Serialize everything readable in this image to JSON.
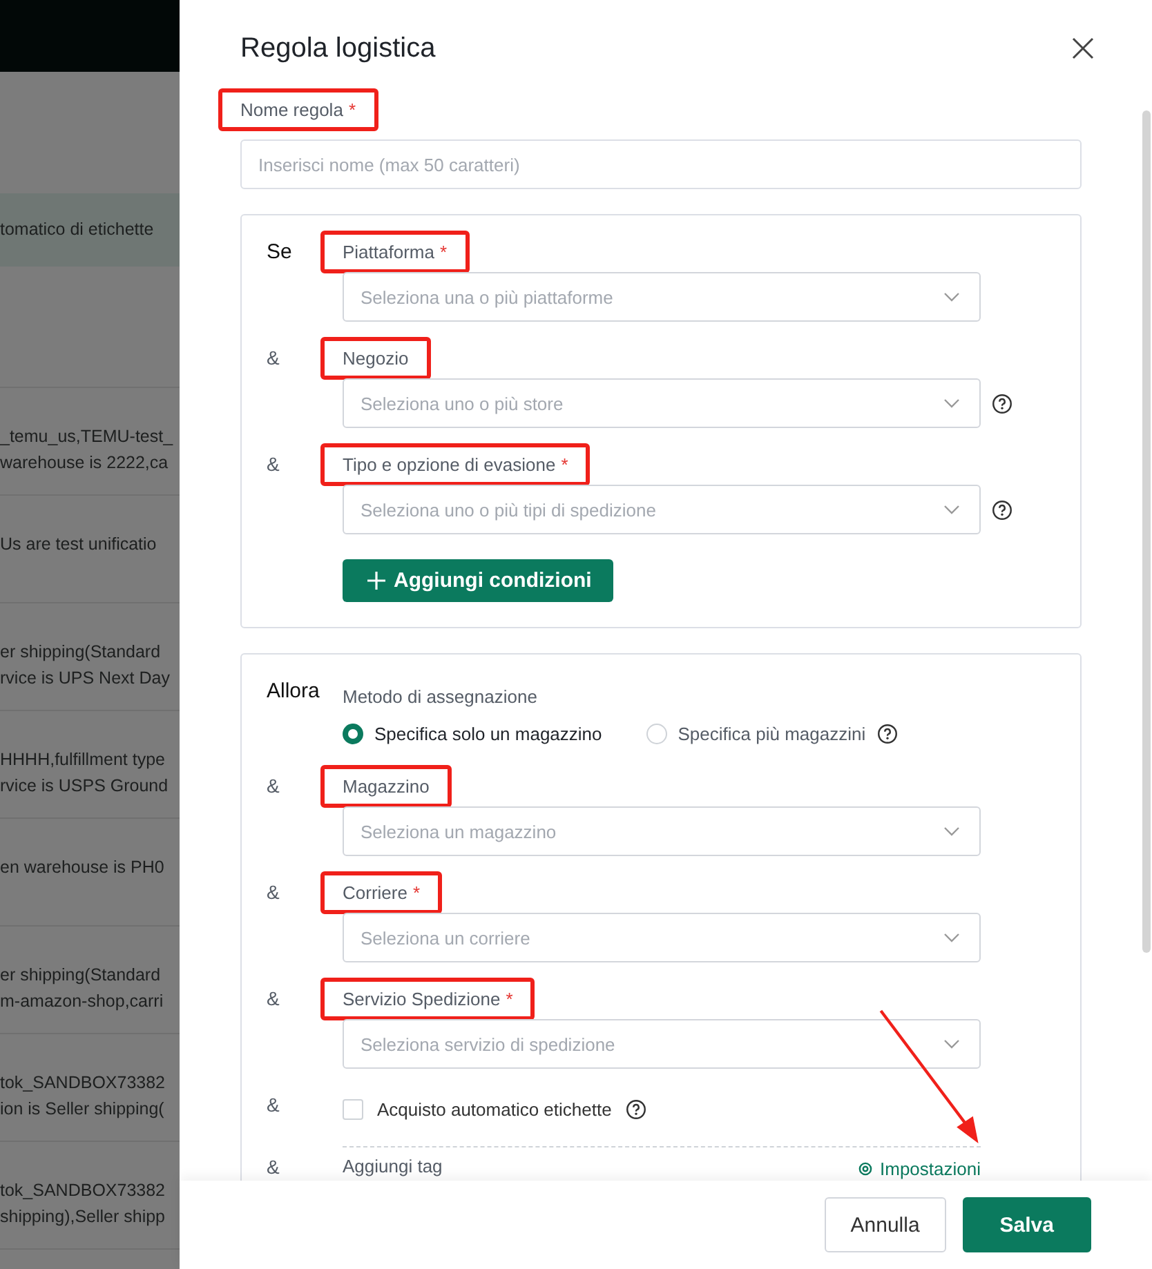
{
  "background": {
    "banner": "tomatico di etichette",
    "rows": [
      {
        "lines": [
          "_temu_us,TEMU-test_",
          "warehouse is 2222,ca"
        ]
      },
      {
        "lines": [
          "Us are test unificatio"
        ]
      },
      {
        "lines": [
          "er shipping(Standard",
          "rvice is UPS Next Day"
        ]
      },
      {
        "lines": [
          "HHHH,fulfillment type",
          "rvice is USPS Ground"
        ]
      },
      {
        "lines": [
          "en warehouse is PH0"
        ]
      },
      {
        "lines": [
          "er shipping(Standard",
          "m-amazon-shop,carri"
        ]
      },
      {
        "lines": [
          "tok_SANDBOX73382",
          "ion is Seller shipping("
        ]
      },
      {
        "lines": [
          "tok_SANDBOX73382",
          "shipping),Seller shipp"
        ]
      }
    ]
  },
  "drawer": {
    "title": "Regola logistica",
    "name_field": {
      "label": "Nome regola",
      "required_mark": "*",
      "placeholder": "Inserisci nome (max 50 caratteri)",
      "highlighted": true
    },
    "conditions": {
      "heading": "Se",
      "items": [
        {
          "label": "Piattaforma",
          "required_mark": "*",
          "placeholder": "Seleziona una o più piattaforme",
          "help": false,
          "highlighted": true
        },
        {
          "prefix": "&",
          "label": "Negozio",
          "placeholder": "Seleziona uno o più store",
          "help": true,
          "highlighted": true
        },
        {
          "prefix": "&",
          "label": "Tipo e opzione di evasione",
          "required_mark": "*",
          "placeholder": "Seleziona uno o più tipi di spedizione",
          "help": true,
          "highlighted": true
        }
      ],
      "add_button": "Aggiungi condizioni"
    },
    "actions": {
      "heading": "Allora",
      "method": {
        "label": "Metodo di assegnazione",
        "options": [
          {
            "label": "Specifica solo un magazzino",
            "selected": true,
            "help": false
          },
          {
            "label": "Specifica più magazzini",
            "selected": false,
            "help": true
          }
        ]
      },
      "items": [
        {
          "kind": "select",
          "prefix": "&",
          "label": "Magazzino",
          "placeholder": "Seleziona un magazzino",
          "help": false,
          "highlighted": true
        },
        {
          "kind": "select",
          "prefix": "&",
          "label": "Corriere",
          "required_mark": "*",
          "placeholder": "Seleziona un corriere",
          "help": false,
          "highlighted": true
        },
        {
          "kind": "select",
          "prefix": "&",
          "label": "Servizio Spedizione",
          "required_mark": "*",
          "placeholder": "Seleziona servizio di spedizione",
          "help": false,
          "highlighted": true
        },
        {
          "kind": "checkbox",
          "prefix": "&",
          "label": "Acquisto automatico etichette",
          "checked": false,
          "help": true
        },
        {
          "kind": "tag",
          "prefix": "&",
          "label": "Aggiungi tag",
          "link": "Impostazioni"
        }
      ]
    }
  },
  "footer": {
    "buttons": [
      {
        "label": "Annulla",
        "kind": "secondary"
      },
      {
        "label": "Salva",
        "kind": "primary"
      }
    ]
  }
}
